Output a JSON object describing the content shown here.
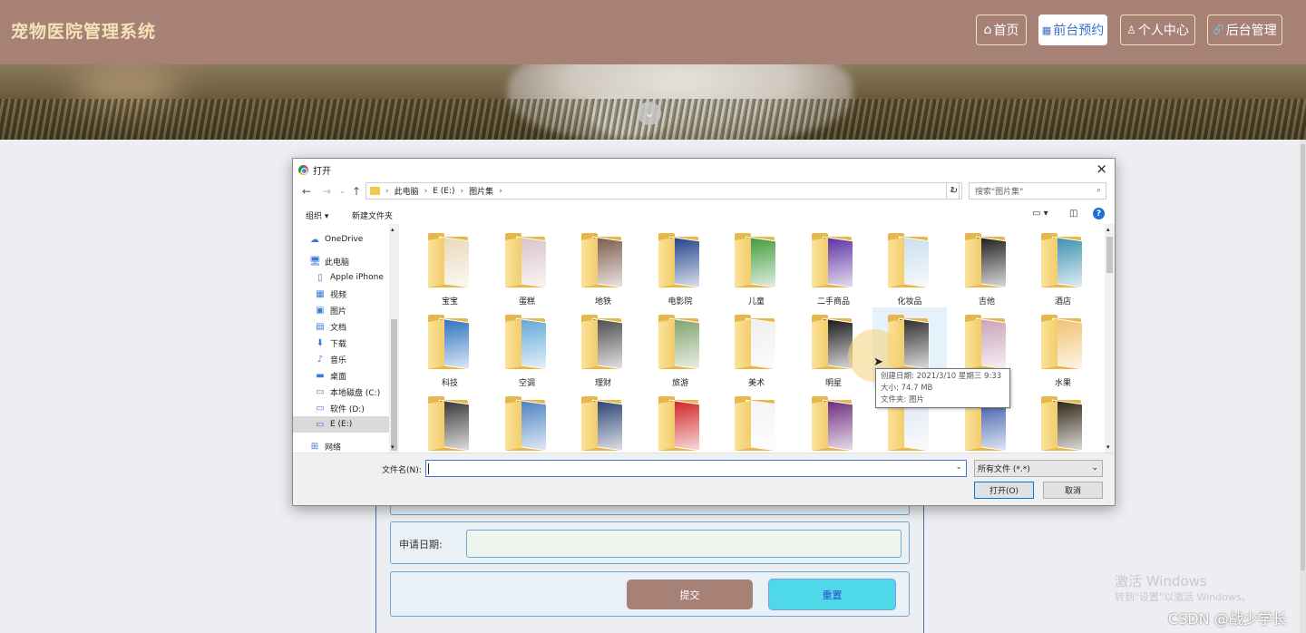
{
  "header": {
    "site_title": "宠物医院管理系统",
    "nav": [
      {
        "icon": "home-icon",
        "glyph": "⌂",
        "label": "首页"
      },
      {
        "icon": "grid-icon",
        "glyph": "▦",
        "label": "前台预约"
      },
      {
        "icon": "user-icon",
        "glyph": "♙",
        "label": "个人中心"
      },
      {
        "icon": "link-icon",
        "glyph": "🔗",
        "label": "后台管理"
      }
    ],
    "active_nav": "前台预约",
    "colors": {
      "bar": "#a88176",
      "title": "#f3e3b6",
      "active_text": "#3a6ec8"
    }
  },
  "banner": {
    "scroll_glyph": "⌄"
  },
  "form": {
    "date_label": "申请日期:",
    "date_value": "",
    "submit_label": "提交",
    "reset_label": "重置",
    "colors": {
      "submit": "#a88176",
      "reset": "#4fd8e8"
    }
  },
  "dialog": {
    "title": "打开",
    "close_glyph": "×",
    "path": [
      "此电脑",
      "E (E:)",
      "图片集"
    ],
    "search_placeholder": "搜索\"图片集\"",
    "toolbar": {
      "organize": "组织 ▾",
      "new_folder": "新建文件夹"
    },
    "nav_items": [
      {
        "icon": "cloud-icon",
        "glyph": "☁",
        "label": "OneDrive"
      },
      {
        "icon": "computer-icon",
        "glyph": "🖥",
        "label": "此电脑"
      },
      {
        "icon": "phone-icon",
        "glyph": "▯",
        "label": "Apple iPhone"
      },
      {
        "icon": "video-icon",
        "glyph": "▦",
        "label": "视频"
      },
      {
        "icon": "picture-icon",
        "glyph": "▣",
        "label": "图片"
      },
      {
        "icon": "document-icon",
        "glyph": "▤",
        "label": "文档"
      },
      {
        "icon": "download-icon",
        "glyph": "⬇",
        "label": "下载"
      },
      {
        "icon": "music-icon",
        "glyph": "♪",
        "label": "音乐"
      },
      {
        "icon": "desktop-icon",
        "glyph": "▬",
        "label": "桌面"
      },
      {
        "icon": "disk-icon",
        "glyph": "▭",
        "label": "本地磁盘 (C:)"
      },
      {
        "icon": "disk-icon",
        "glyph": "▭",
        "label": "软件 (D:)"
      },
      {
        "icon": "disk-icon",
        "glyph": "▭",
        "label": "E (E:)"
      },
      {
        "icon": "network-icon",
        "glyph": "⊞",
        "label": "网络"
      }
    ],
    "selected_nav": "E (E:)",
    "folders": [
      {
        "name": "宝宝",
        "tint": "#e8d8b8"
      },
      {
        "name": "蛋糕",
        "tint": "#d9c2c6"
      },
      {
        "name": "地铁",
        "tint": "#7a5a48"
      },
      {
        "name": "电影院",
        "tint": "#1e3f8a"
      },
      {
        "name": "儿童",
        "tint": "#3f9a3a"
      },
      {
        "name": "二手商品",
        "tint": "#5a2ea0"
      },
      {
        "name": "化妆品",
        "tint": "#c8dff0"
      },
      {
        "name": "吉他",
        "tint": "#1e1a1a"
      },
      {
        "name": "酒店",
        "tint": "#3a8fb0"
      },
      {
        "name": "科技",
        "tint": "#2a6fbf"
      },
      {
        "name": "空调",
        "tint": "#5fa6d6"
      },
      {
        "name": "理财",
        "tint": "#4a4a4a"
      },
      {
        "name": "旅游",
        "tint": "#7da36a"
      },
      {
        "name": "美术",
        "tint": "#eeeeee"
      },
      {
        "name": "明星",
        "tint": "#151515"
      },
      {
        "name": "",
        "tint": "#2a2a2a"
      },
      {
        "name": "",
        "tint": "#c9a0b8"
      },
      {
        "name": "水果",
        "tint": "#f0c070"
      },
      {
        "name": "",
        "tint": "#333333"
      },
      {
        "name": "",
        "tint": "#4a7fc0"
      },
      {
        "name": "",
        "tint": "#2a4070"
      },
      {
        "name": "",
        "tint": "#d02020"
      },
      {
        "name": "",
        "tint": "#f4f4f4"
      },
      {
        "name": "",
        "tint": "#6a2a7a"
      },
      {
        "name": "",
        "tint": "#dfe8f4"
      },
      {
        "name": "",
        "tint": "#3a5aa8"
      },
      {
        "name": "",
        "tint": "#2a2010"
      }
    ],
    "tooltip": {
      "created": "创建日期: 2021/3/10 星期三 9:33",
      "size": "大小: 74.7 MB",
      "contains": "文件夹: 图片"
    },
    "filename_label": "文件名(N):",
    "filename_value": "",
    "filter_value": "所有文件 (*.*)",
    "open_label": "打开(O)",
    "cancel_label": "取消"
  },
  "watermarks": {
    "windows_line1": "激活 Windows",
    "windows_line2": "转到\"设置\"以激活 Windows。",
    "csdn": "CSDN @战少学长"
  }
}
